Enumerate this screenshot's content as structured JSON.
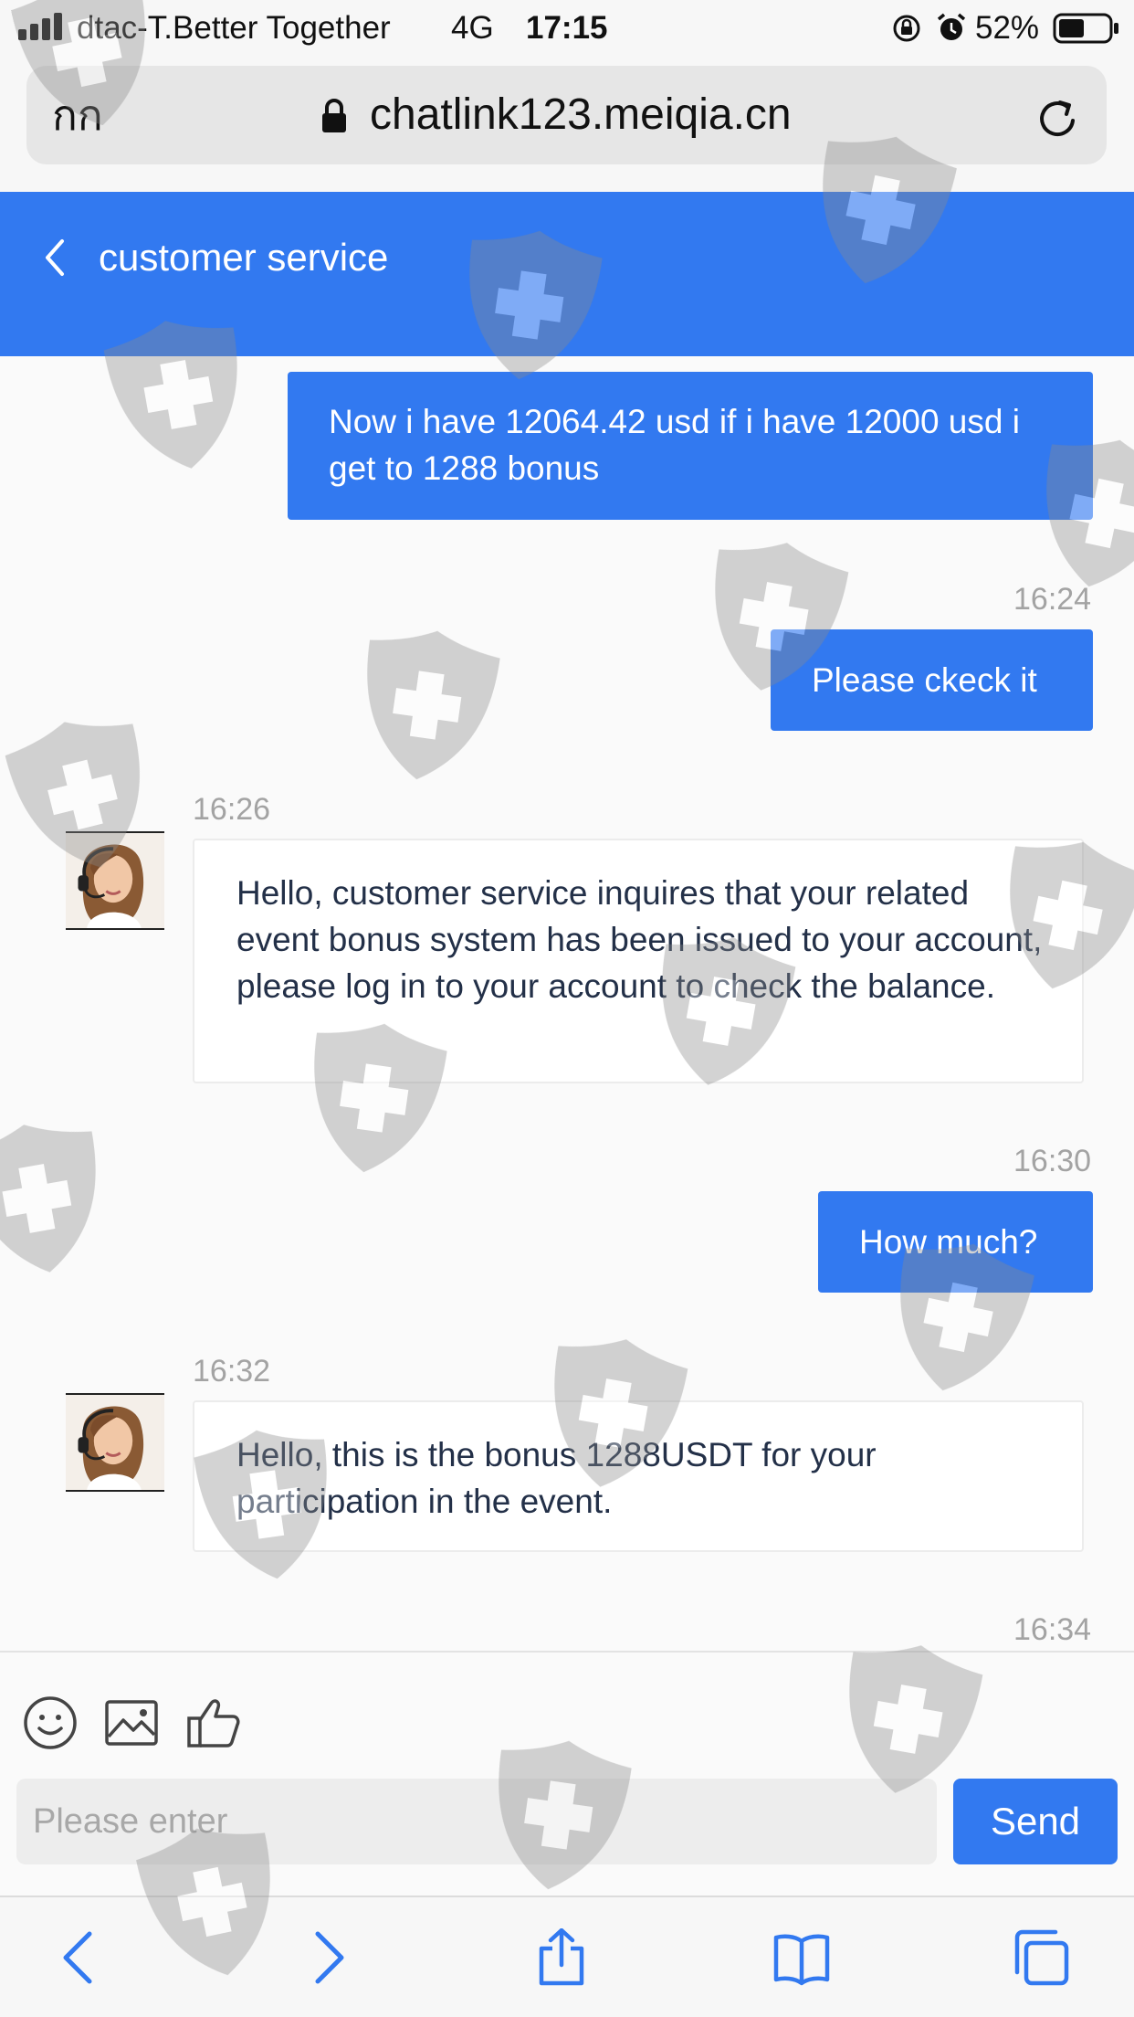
{
  "status_bar": {
    "carrier": "dtac-T.Better Together",
    "network": "4G",
    "time": "17:15",
    "battery_percent": "52%",
    "battery_level": 0.52
  },
  "browser": {
    "reader_button": "กก",
    "url": "chatlink123.meiqia.cn"
  },
  "chat": {
    "title": "customer service",
    "messages": [
      {
        "direction": "out",
        "time": "",
        "text": "Now i have 12064.42 usd if i have 12000 usd i get to 1288 bonus"
      },
      {
        "direction": "out",
        "time": "16:24",
        "text": "Please ckeck it"
      },
      {
        "direction": "in",
        "time": "16:26",
        "text": "Hello, customer service inquires that your related event bonus system has been issued to your account, please log in to your account to check the balance."
      },
      {
        "direction": "out",
        "time": "16:30",
        "text": "How much?"
      },
      {
        "direction": "in",
        "time": "16:32",
        "text": "Hello, this is the bonus 1288USDT for your participation in the event."
      },
      {
        "direction": "out",
        "time": "16:34",
        "text": ""
      }
    ]
  },
  "composer": {
    "placeholder": "Please enter",
    "send_label": "Send",
    "tools": [
      "emoji-icon",
      "image-icon",
      "thumbs-up-icon"
    ]
  },
  "toolbar": {
    "icons": [
      "back-icon",
      "forward-icon",
      "share-icon",
      "bookmarks-icon",
      "tabs-icon"
    ]
  },
  "colors": {
    "accent": "#3279f0",
    "incoming_text": "#233048",
    "timestamp": "#a3a3a3"
  }
}
